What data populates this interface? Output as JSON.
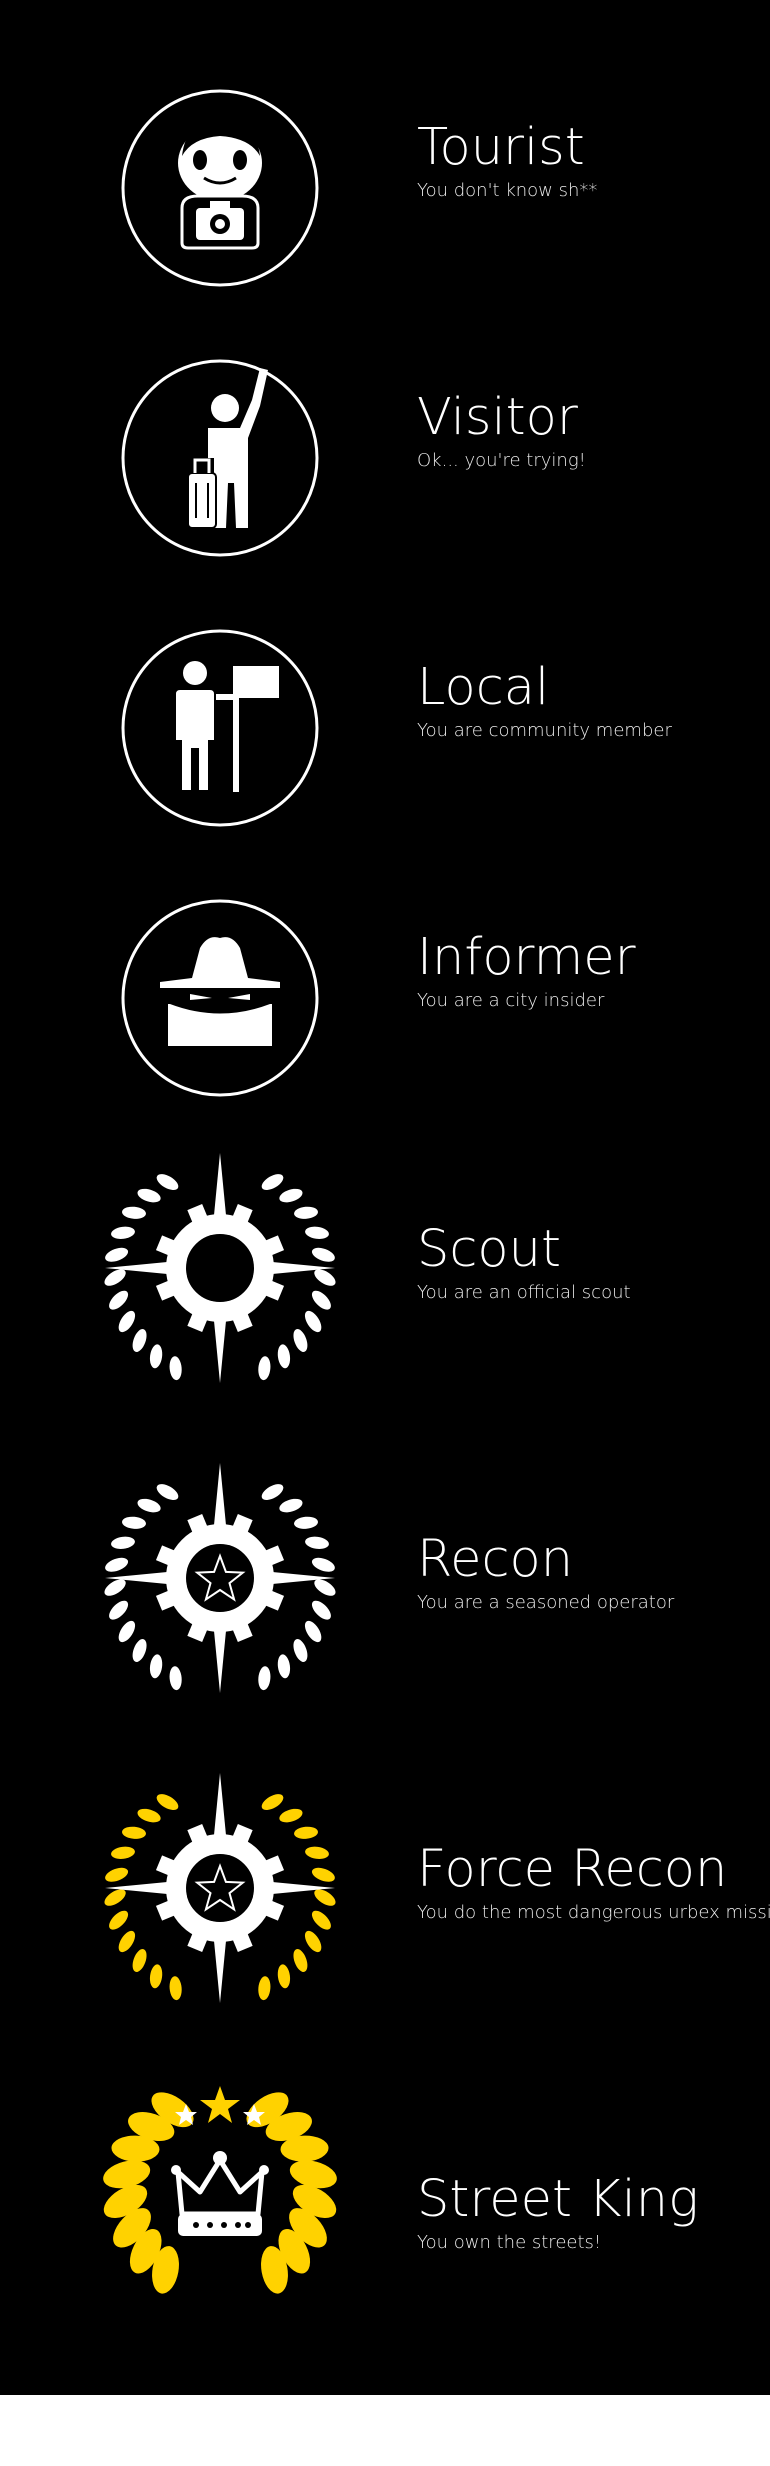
{
  "colors": {
    "background": "#000000",
    "foreground": "#ffffff",
    "gold": "#ffd200",
    "footer": "#ffffff"
  },
  "ranks": [
    {
      "title": "Tourist",
      "subtitle": "You don't know sh**",
      "icon": "tourist-camera-icon"
    },
    {
      "title": "Visitor",
      "subtitle": "Ok... you're trying!",
      "icon": "traveler-luggage-icon"
    },
    {
      "title": "Local",
      "subtitle": "You are community member",
      "icon": "person-flag-icon"
    },
    {
      "title": "Informer",
      "subtitle": "You are a city insider",
      "icon": "spy-hat-icon"
    },
    {
      "title": "Scout",
      "subtitle": "You are an official scout",
      "icon": "compass-laurel-icon"
    },
    {
      "title": "Recon",
      "subtitle": "You are a seasoned operator",
      "icon": "compass-star-laurel-icon"
    },
    {
      "title": "Force Recon",
      "subtitle": "You do the most dangerous urbex missions",
      "icon": "gold-compass-star-laurel-icon"
    },
    {
      "title": "Street King",
      "subtitle": "You own the streets!",
      "icon": "gold-crown-laurel-icon"
    }
  ]
}
